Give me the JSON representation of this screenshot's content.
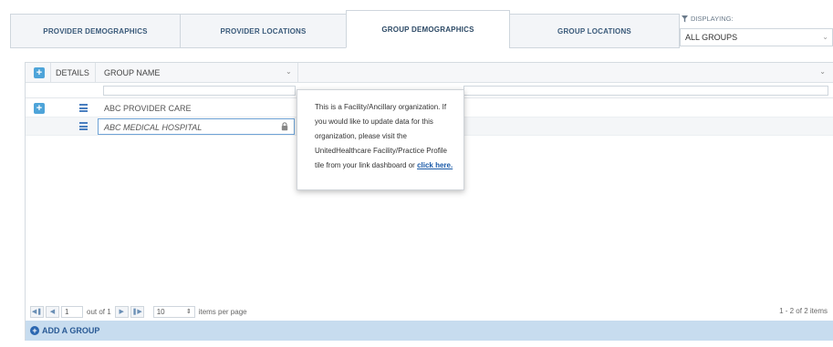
{
  "tabs": [
    {
      "label": "PROVIDER DEMOGRAPHICS",
      "active": false
    },
    {
      "label": "PROVIDER LOCATIONS",
      "active": false
    },
    {
      "label": "GROUP DEMOGRAPHICS",
      "active": true
    },
    {
      "label": "GROUP LOCATIONS",
      "active": false
    }
  ],
  "displaying": {
    "label": "DISPLAYING:",
    "value": "ALL GROUPS"
  },
  "grid": {
    "headers": {
      "details": "DETAILS",
      "group_name": "GROUP NAME"
    },
    "rows": [
      {
        "name": "ABC PROVIDER CARE"
      },
      {
        "name": "ABC MEDICAL HOSPITAL"
      }
    ]
  },
  "tooltip": {
    "text": "This is a Facility/Ancillary organization. If you would like to update data for this organization, please visit the UnitedHealthcare Facility/Practice Profile tile from your link dashboard or",
    "link": "click here."
  },
  "pager": {
    "page": "1",
    "out_of": "out of 1",
    "page_size": "10",
    "per_page_label": "items per page",
    "summary": "1 - 2 of 2 items"
  },
  "add_group_label": "ADD A GROUP"
}
